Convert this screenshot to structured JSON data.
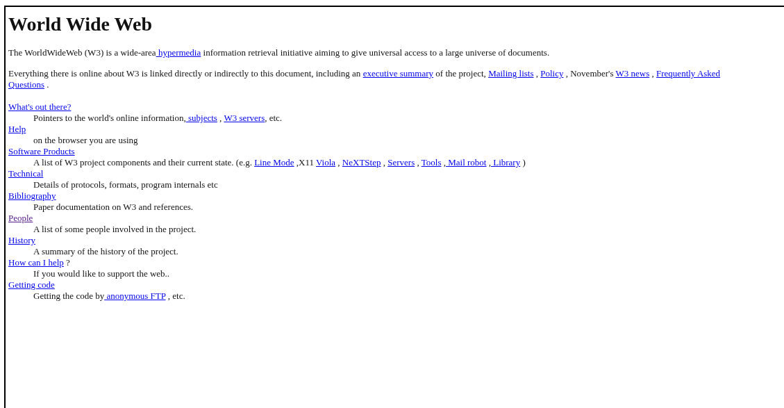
{
  "heading": "World Wide Web",
  "paragraphs": [
    [
      {
        "kind": "text",
        "text": "The WorldWideWeb (W3) is a wide-area"
      },
      {
        "kind": "link",
        "text": " hypermedia",
        "visited": false
      },
      {
        "kind": "text",
        "text": " information retrieval initiative aiming to give universal access to a large universe of documents."
      }
    ],
    [
      {
        "kind": "text",
        "text": "Everything there is online about W3 is linked directly or indirectly to this document, including an "
      },
      {
        "kind": "link",
        "text": "executive summary",
        "visited": false
      },
      {
        "kind": "text",
        "text": " of the project, "
      },
      {
        "kind": "link",
        "text": "Mailing lists",
        "visited": false
      },
      {
        "kind": "text",
        "text": " , "
      },
      {
        "kind": "link",
        "text": "Policy",
        "visited": false
      },
      {
        "kind": "text",
        "text": " , November's "
      },
      {
        "kind": "link",
        "text": "W3 news",
        "visited": false
      },
      {
        "kind": "text",
        "text": " , "
      },
      {
        "kind": "link",
        "text": "Frequently Asked",
        "visited": false
      },
      {
        "kind": "break"
      },
      {
        "kind": "link",
        "text": "Questions",
        "visited": false
      },
      {
        "kind": "text",
        "text": " ."
      }
    ]
  ],
  "topics": [
    {
      "term": [
        {
          "kind": "link",
          "text": "What's out there?",
          "visited": false
        }
      ],
      "definition": [
        {
          "kind": "text",
          "text": "Pointers to the world's online information,"
        },
        {
          "kind": "link",
          "text": " subjects",
          "visited": false
        },
        {
          "kind": "text",
          "text": " , "
        },
        {
          "kind": "link",
          "text": "W3 servers",
          "visited": false
        },
        {
          "kind": "text",
          "text": ", etc."
        }
      ]
    },
    {
      "term": [
        {
          "kind": "link",
          "text": "Help",
          "visited": false
        }
      ],
      "definition": [
        {
          "kind": "text",
          "text": "on the browser you are using"
        }
      ]
    },
    {
      "term": [
        {
          "kind": "link",
          "text": "Software Products",
          "visited": false
        }
      ],
      "definition": [
        {
          "kind": "text",
          "text": "A list of W3 project components and their current state. (e.g. "
        },
        {
          "kind": "link",
          "text": "Line Mode",
          "visited": false
        },
        {
          "kind": "text",
          "text": " ,X11 "
        },
        {
          "kind": "link",
          "text": "Viola",
          "visited": false
        },
        {
          "kind": "text",
          "text": " , "
        },
        {
          "kind": "link",
          "text": "NeXTStep",
          "visited": false
        },
        {
          "kind": "text",
          "text": " , "
        },
        {
          "kind": "link",
          "text": "Servers",
          "visited": false
        },
        {
          "kind": "text",
          "text": " , "
        },
        {
          "kind": "link",
          "text": "Tools",
          "visited": false
        },
        {
          "kind": "text",
          "text": " ,"
        },
        {
          "kind": "link",
          "text": " Mail robot",
          "visited": false
        },
        {
          "kind": "text",
          "text": " ,"
        },
        {
          "kind": "link",
          "text": " Library",
          "visited": false
        },
        {
          "kind": "text",
          "text": " )"
        }
      ]
    },
    {
      "term": [
        {
          "kind": "link",
          "text": "Technical",
          "visited": false
        }
      ],
      "definition": [
        {
          "kind": "text",
          "text": "Details of protocols, formats, program internals etc"
        }
      ]
    },
    {
      "term": [
        {
          "kind": "link",
          "text": "Bibliography",
          "visited": false
        }
      ],
      "definition": [
        {
          "kind": "text",
          "text": "Paper documentation on W3 and references."
        }
      ]
    },
    {
      "term": [
        {
          "kind": "link",
          "text": "People",
          "visited": true
        }
      ],
      "definition": [
        {
          "kind": "text",
          "text": "A list of some people involved in the project."
        }
      ]
    },
    {
      "term": [
        {
          "kind": "link",
          "text": "History",
          "visited": false
        }
      ],
      "definition": [
        {
          "kind": "text",
          "text": "A summary of the history of the project."
        }
      ]
    },
    {
      "term": [
        {
          "kind": "link",
          "text": "How can I help",
          "visited": false
        },
        {
          "kind": "text",
          "text": " ?"
        }
      ],
      "definition": [
        {
          "kind": "text",
          "text": "If you would like to support the web.."
        }
      ]
    },
    {
      "term": [
        {
          "kind": "link",
          "text": "Getting code",
          "visited": false
        }
      ],
      "definition": [
        {
          "kind": "text",
          "text": "Getting the code by"
        },
        {
          "kind": "link",
          "text": " anonymous FTP",
          "visited": false
        },
        {
          "kind": "text",
          "text": " , etc."
        }
      ]
    }
  ]
}
